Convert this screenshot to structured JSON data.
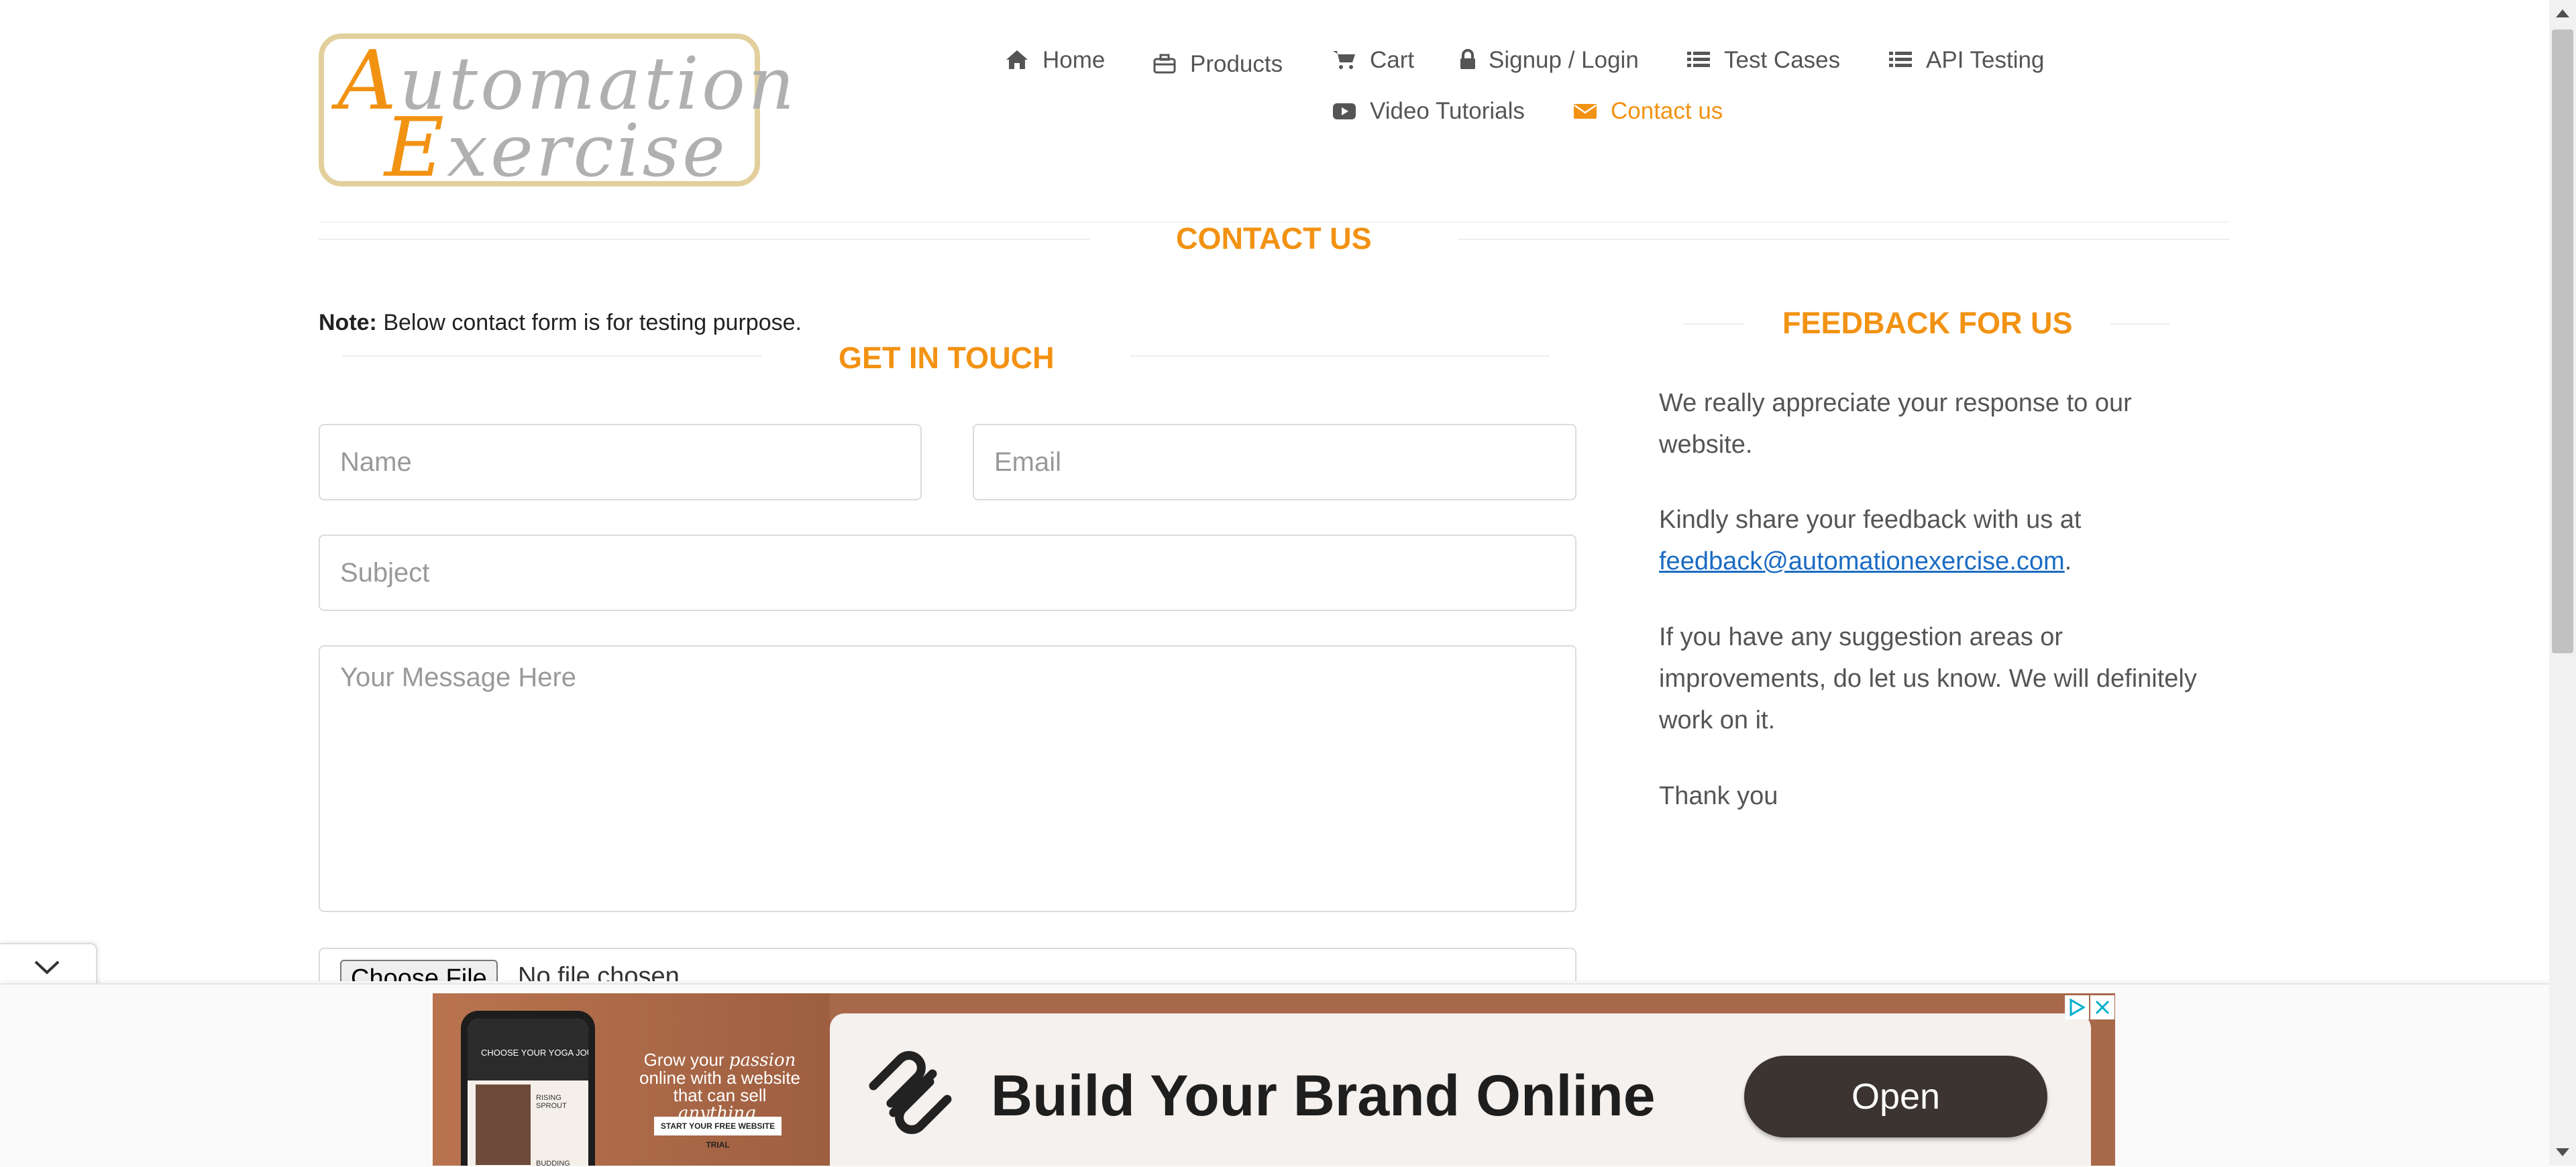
{
  "header": {
    "logo": {
      "line1": "Automation",
      "line2": "Exercise"
    },
    "nav": [
      {
        "label": "Home",
        "icon": "home-icon"
      },
      {
        "label": "Products",
        "icon": "briefcase-icon"
      },
      {
        "label": "Cart",
        "icon": "cart-icon"
      },
      {
        "label": "Signup / Login",
        "icon": "lock-icon"
      },
      {
        "label": "Test Cases",
        "icon": "list-icon"
      },
      {
        "label": "API Testing",
        "icon": "list-icon"
      },
      {
        "label": "Video Tutorials",
        "icon": "youtube-icon"
      },
      {
        "label": "Contact us",
        "icon": "envelope-icon",
        "active": true
      }
    ]
  },
  "contact": {
    "title": "CONTACT US",
    "note_bold": "Note:",
    "note_text": " Below contact form is for testing purpose.",
    "form_title": "GET IN TOUCH",
    "name_placeholder": "Name",
    "email_placeholder": "Email",
    "subject_placeholder": "Subject",
    "message_placeholder": "Your Message Here",
    "choose_file_label": "Choose File",
    "file_status": "No file chosen"
  },
  "feedback": {
    "title": "FEEDBACK FOR US",
    "p1": "We really appreciate your response to our website.",
    "p2_prefix": "Kindly share your feedback with us at ",
    "p2_email": "feedback@automationexercise.com",
    "p2_suffix": ".",
    "p3": "If you have any suggestion areas or improvements, do let us know. We will definitely work on it.",
    "p4": "Thank you"
  },
  "ad": {
    "phone_heading": "CHOOSE YOUR YOGA JOURNEY",
    "phone_item1": "RISING SPROUT",
    "phone_item2": "BUDDING EXPERT",
    "tagline_1": "Grow your ",
    "tagline_italic1": "passion",
    "tagline_2": " online with a website that can sell ",
    "tagline_italic2": "anything.",
    "cta_small": "START YOUR FREE WEBSITE TRIAL",
    "headline": "Build Your Brand Online",
    "button": "Open"
  },
  "colors": {
    "accent": "#f29212",
    "link": "#1a6bc2",
    "text": "#555555",
    "ad_background": "#a8694a",
    "ad_button": "#3b3430"
  }
}
